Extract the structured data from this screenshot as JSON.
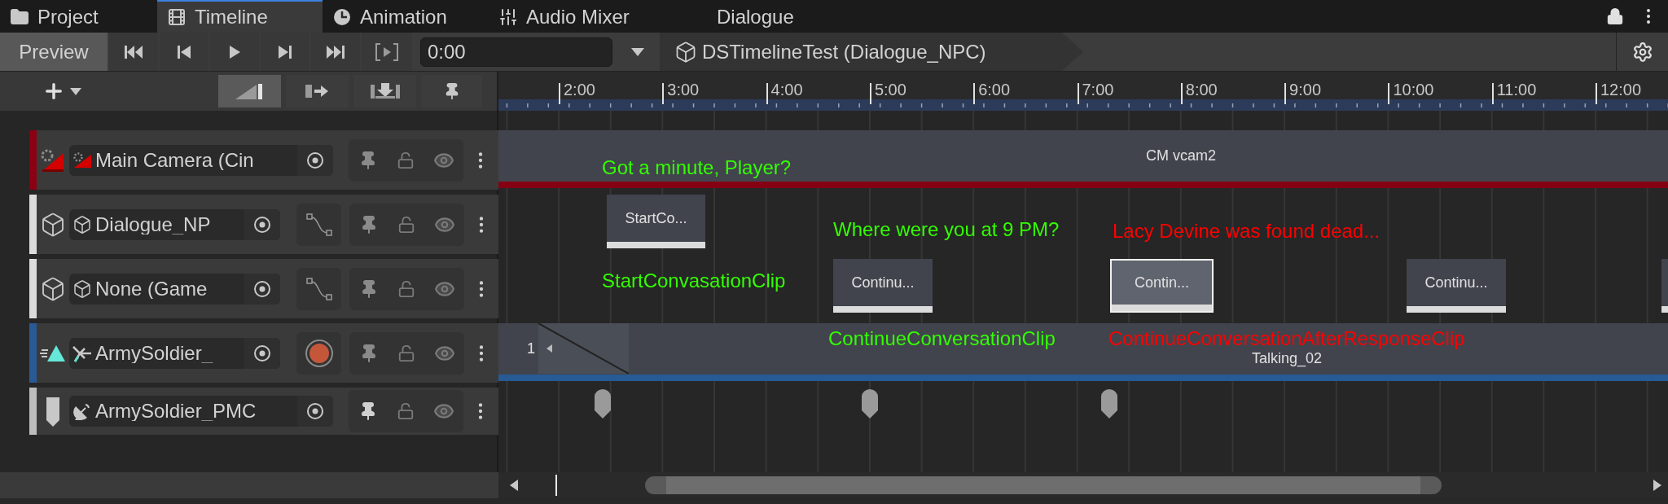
{
  "tabs": [
    {
      "label": "Project",
      "selected": false
    },
    {
      "label": "Timeline",
      "selected": true
    },
    {
      "label": "Animation",
      "selected": false
    },
    {
      "label": "Audio Mixer",
      "selected": false
    },
    {
      "label": "Dialogue",
      "selected": false
    }
  ],
  "toolbar": {
    "preview": {
      "label": "Preview",
      "selected": true
    },
    "time_field": {
      "value": "0:00"
    },
    "breadcrumb": "DSTimelineTest (Dialogue_NPC)"
  },
  "edit_modes": [
    {
      "selected": true
    },
    {
      "selected": false
    },
    {
      "selected": false
    }
  ],
  "ruler": {
    "ticks": [
      "2:00",
      "3:00",
      "4:00",
      "5:00",
      "6:00",
      "7:00",
      "8:00",
      "9:00",
      "10:00",
      "11:00",
      "12:00"
    ]
  },
  "tracks": [
    {
      "kind": "camera",
      "name": "Main Camera (Cin",
      "color": "#8b0012",
      "clips": [
        {
          "label": "CM vcam2",
          "selected": false
        }
      ]
    },
    {
      "kind": "activation",
      "name": "Dialogue_NP",
      "color": "#dcdcdc",
      "clips": [
        {
          "label": "StartCo...",
          "selected": false
        }
      ]
    },
    {
      "kind": "activation",
      "name": "None (Game",
      "color": "#dcdcdc",
      "clips": [
        {
          "label": "Continu...",
          "selected": false
        },
        {
          "label": "Contin...",
          "selected": true
        },
        {
          "label": "Continu...",
          "selected": false
        },
        {
          "selected": false
        }
      ]
    },
    {
      "kind": "animation",
      "name": "ArmySoldier_",
      "color": "#2a5a96",
      "clips": [
        {
          "label": "1",
          "selected": false
        },
        {
          "label": "Talking_02",
          "selected": false
        }
      ]
    },
    {
      "kind": "signal",
      "name": "ArmySoldier_PMC",
      "color": "#bdbdbd",
      "markers": [
        {
          "selected": false
        },
        {
          "selected": false
        },
        {
          "selected": false
        }
      ]
    }
  ],
  "overlay_texts": [
    {
      "text": "Got a minute, Player?",
      "color": "#33ff00"
    },
    {
      "text": "Where were you at 9 PM?",
      "color": "#33ff00"
    },
    {
      "text": "Lacy Devine was found dead...",
      "color": "#ff0000"
    },
    {
      "text": "StartConvasationClip",
      "color": "#33ff00"
    },
    {
      "text": "ContinueConversationClip",
      "color": "#33ff00"
    },
    {
      "text": "ContinueConversationAfterResponseClip",
      "color": "#ff0000"
    }
  ]
}
